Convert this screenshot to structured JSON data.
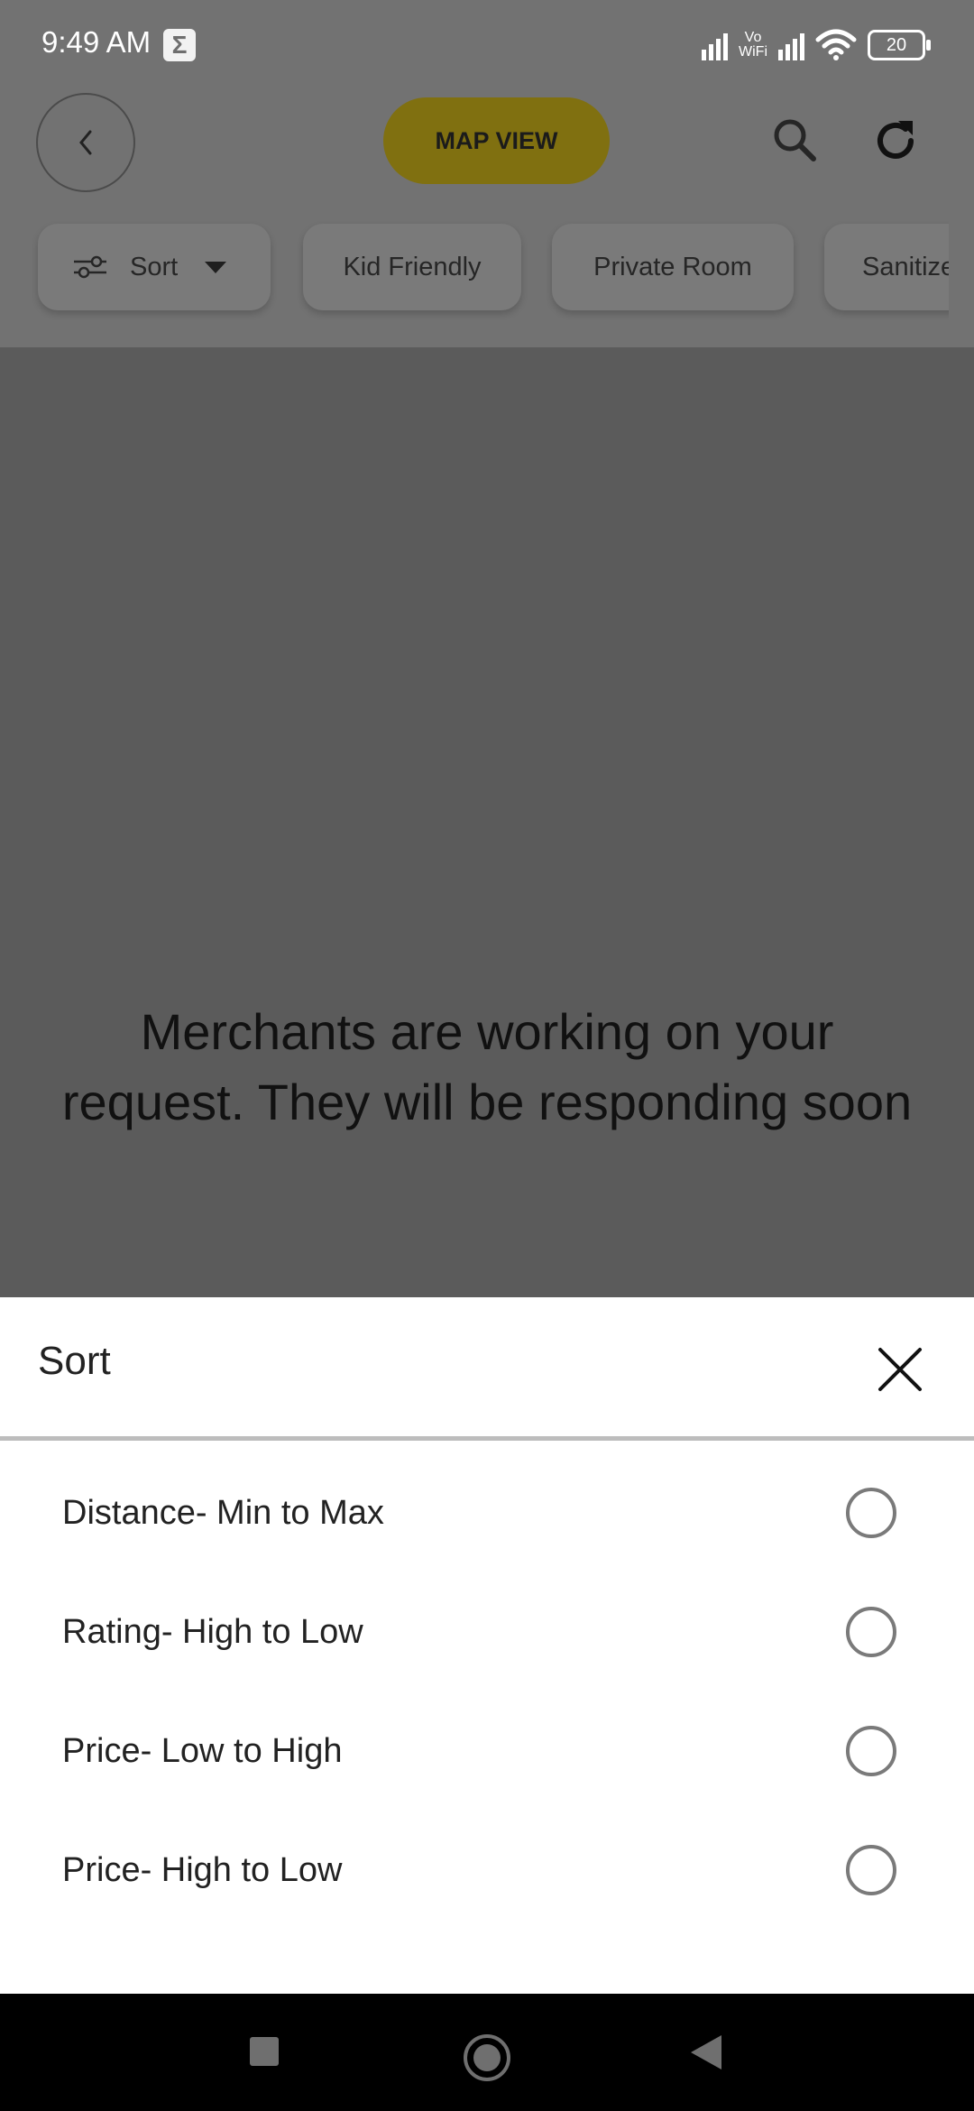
{
  "status_bar": {
    "time": "9:49 AM",
    "notification_icon": "sigma-icon",
    "network_label_top": "Vo",
    "network_label_bottom": "WiFi",
    "battery": "20"
  },
  "header": {
    "back_icon": "chevron-left-icon",
    "map_view_label": "MAP VIEW",
    "search_icon": "search-icon",
    "refresh_icon": "refresh-icon"
  },
  "filters": {
    "sort_label": "Sort",
    "chips": [
      "Kid Friendly",
      "Private Room",
      "Sanitize"
    ]
  },
  "main": {
    "message_line1": "Merchants are working on your",
    "message_line2": "request. They will be responding soon"
  },
  "sort_sheet": {
    "title": "Sort",
    "options": [
      {
        "label": "Distance- Min to Max",
        "selected": false
      },
      {
        "label": "Rating- High to Low",
        "selected": false
      },
      {
        "label": "Price- Low to High",
        "selected": false
      },
      {
        "label": "Price- High to Low",
        "selected": false
      }
    ]
  },
  "colors": {
    "accent": "#F5D218",
    "scrim": "#5B5B5B",
    "sheet": "#FFFFFF"
  }
}
